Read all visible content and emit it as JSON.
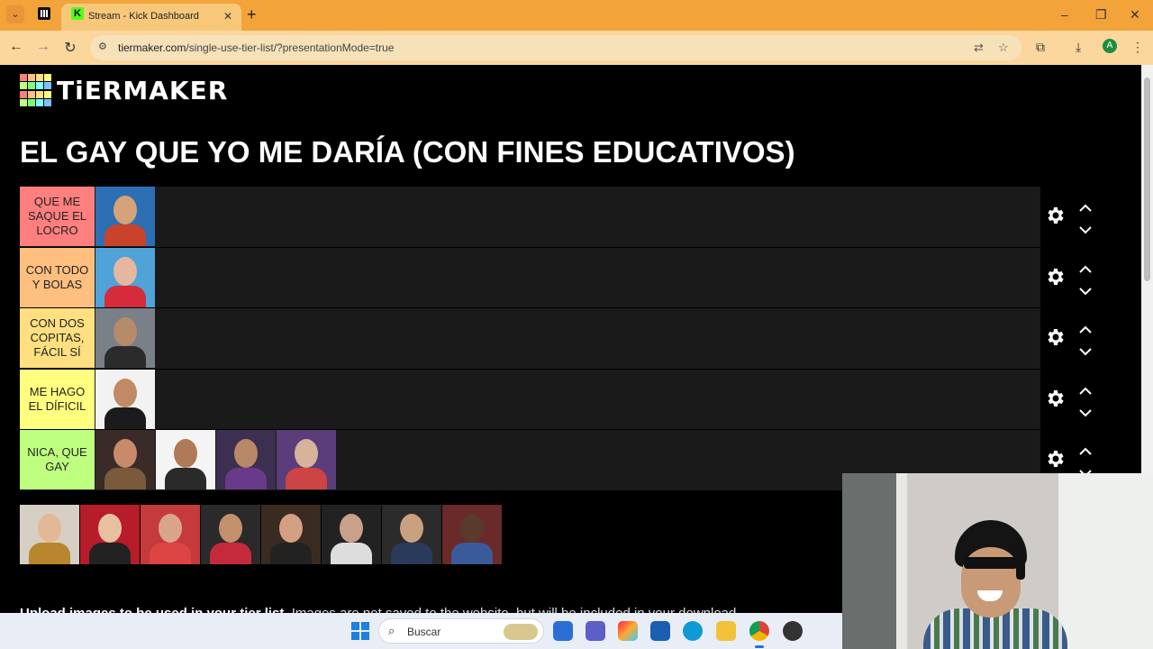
{
  "browser": {
    "tabs": [
      {
        "title": "",
        "pinned": true,
        "icon": "tiermaker-favicon"
      },
      {
        "title": "Stream - Kick Dashboard",
        "active": true,
        "icon": "kick-favicon"
      }
    ],
    "url_host": "tiermaker.com",
    "url_path": "/single-use-tier-list/?presentationMode=true",
    "profile_initial": "A"
  },
  "page": {
    "logo_text": "TiERMAKER",
    "logo_colors": [
      "#ff7f7f",
      "#ffbf7f",
      "#ffdf7f",
      "#ffff7f",
      "#bfff7f",
      "#7fff7f",
      "#7fffff",
      "#7fbfff",
      "#ff7f7f",
      "#ffbf7f",
      "#ffdf7f",
      "#ffff7f",
      "#bfff7f",
      "#7fff7f",
      "#7fffff",
      "#7fbfff"
    ],
    "title": "EL GAY QUE YO ME DARÍA (CON FINES EDUCATIVOS)",
    "upload_bold": "Upload images to be used in your tier list.",
    "upload_rest": " Images are not saved to the website, but will be included in your download."
  },
  "tiers": [
    {
      "label": "QUE ME SAQUE EL LOCRO",
      "color": "#ff7f7f",
      "items": 1
    },
    {
      "label": "CON TODO Y BOLAS",
      "color": "#ffbf7f",
      "items": 1
    },
    {
      "label": "CON DOS COPITAS, FÁCIL SÍ",
      "color": "#ffdf7f",
      "items": 1
    },
    {
      "label": "ME HAGO EL DÍFICIL",
      "color": "#ffff7f",
      "items": 1
    },
    {
      "label": "NICA, QUE GAY",
      "color": "#bfff7f",
      "items": 4
    }
  ],
  "unranked_items": 8,
  "taskbar": {
    "search_placeholder": "Buscar",
    "apps": [
      "start-icon",
      "search-icon",
      "microsoft-store-icon",
      "teams-icon",
      "copilot-icon",
      "visual-studio-icon",
      "edge-icon",
      "file-explorer-icon",
      "chrome-icon",
      "obs-icon"
    ]
  }
}
